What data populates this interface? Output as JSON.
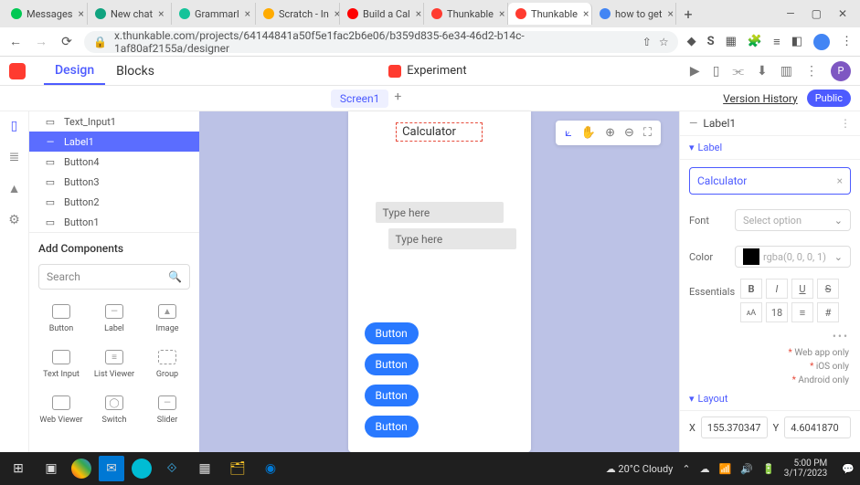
{
  "browser": {
    "tabs": [
      {
        "label": "Messages",
        "fav": "#00c853"
      },
      {
        "label": "New chat",
        "fav": "#10a37f"
      },
      {
        "label": "Grammarl",
        "fav": "#15c39a"
      },
      {
        "label": "Scratch - In",
        "fav": "#ffab00"
      },
      {
        "label": "Build a Cal",
        "fav": "#ff0000"
      },
      {
        "label": "Thunkable",
        "fav": "#ff3b30"
      },
      {
        "label": "Thunkable",
        "fav": "#ff3b30",
        "active": true
      },
      {
        "label": "how to get",
        "fav": "#4285f4"
      }
    ],
    "url": "x.thunkable.com/projects/64144841a50f5e1fac2b6e06/b359d835-6e34-46d2-b14c-1af80af2155a/designer"
  },
  "app": {
    "tabs": {
      "design": "Design",
      "blocks": "Blocks"
    },
    "project_name": "Experiment",
    "avatar_letter": "P",
    "screen_tab": "Screen1",
    "version_history": "Version History",
    "public": "Public"
  },
  "tree": {
    "rows": [
      {
        "label": "Text_Input1",
        "icon": "▭"
      },
      {
        "label": "Label1",
        "icon": "—",
        "selected": true
      },
      {
        "label": "Button4",
        "icon": "▭"
      },
      {
        "label": "Button3",
        "icon": "▭"
      },
      {
        "label": "Button2",
        "icon": "▭"
      },
      {
        "label": "Button1",
        "icon": "▭"
      }
    ]
  },
  "components": {
    "title": "Add Components",
    "search_placeholder": "Search",
    "items": [
      "Button",
      "Label",
      "Image",
      "Text Input",
      "List Viewer",
      "Group",
      "Web Viewer",
      "Switch",
      "Slider"
    ]
  },
  "device": {
    "label_text": "Calculator",
    "text_placeholder": "Type here",
    "buttons": [
      "Button",
      "Button",
      "Button",
      "Button"
    ]
  },
  "inspector": {
    "title": "Label1",
    "section_label": "Label",
    "text_value": "Calculator",
    "font_label": "Font",
    "font_placeholder": "Select option",
    "color_label": "Color",
    "color_value": "rgba(0, 0, 0, 1)",
    "essentials_label": "Essentials",
    "font_size": "18",
    "notes": [
      "Web app only",
      "iOS only",
      "Android only"
    ],
    "layout_label": "Layout",
    "x_label": "X",
    "x_value": "155.370347",
    "y_label": "Y",
    "y_value": "4.6041870"
  },
  "taskbar": {
    "weather": "20°C  Cloudy",
    "time": "5:00 PM",
    "date": "3/17/2023"
  }
}
